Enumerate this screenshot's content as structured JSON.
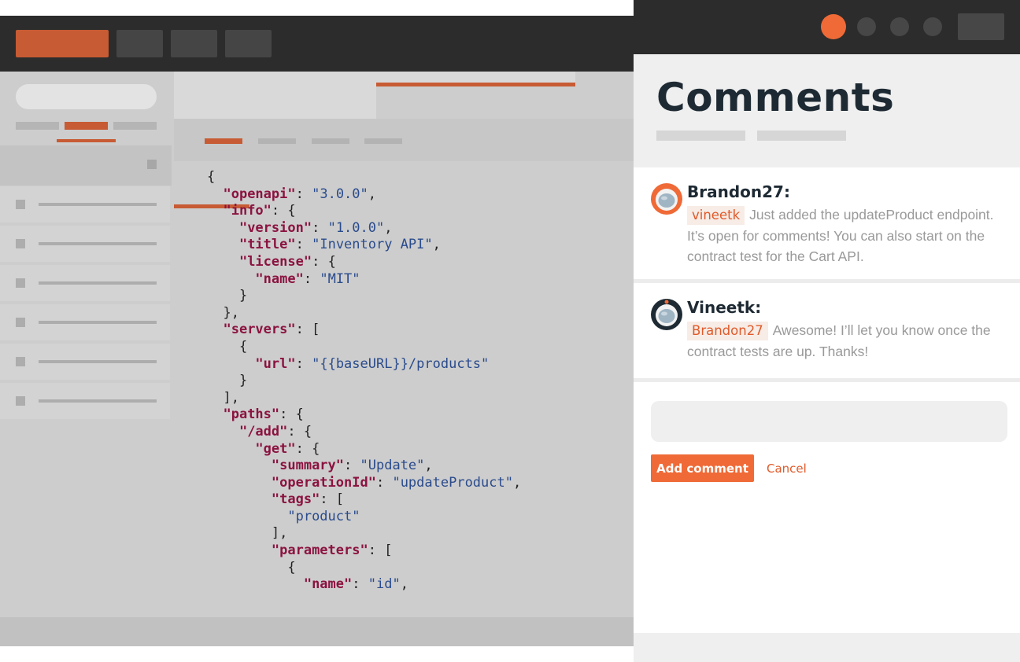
{
  "comments_panel": {
    "title": "Comments",
    "comments": [
      {
        "author": "Brandon27:",
        "mention": "vineetk",
        "text": "Just added the updateProduct endpoint. It’s open for comments! You can also start on the contract test for the Cart API."
      },
      {
        "author": "Vineetk:",
        "mention": "Brandon27",
        "text": "Awesome! I’ll let you know once the contract tests are up. Thanks!"
      }
    ],
    "input_placeholder": "",
    "add_button": "Add comment",
    "cancel": "Cancel"
  },
  "editor": {
    "code_lines": [
      "{",
      "  \"openapi\": \"3.0.0\",",
      "  \"info\": {",
      "    \"version\": \"1.0.0\",",
      "    \"title\": \"Inventory API\",",
      "    \"license\": {",
      "      \"name\": \"MIT\"",
      "    }",
      "  },",
      "  \"servers\": [",
      "    {",
      "      \"url\": \"{{baseURL}}/products\"",
      "    }",
      "  ],",
      "  \"paths\": {",
      "    \"/add\": {",
      "      \"get\": {",
      "        \"summary\": \"Update\",",
      "        \"operationId\": \"updateProduct\",",
      "        \"tags\": [",
      "          \"product\"",
      "        ],",
      "        \"parameters\": [",
      "          {",
      "            \"name\": \"id\","
    ]
  },
  "colors": {
    "accent": "#ef6a37",
    "key": "#8b1340",
    "string": "#2a4b8c",
    "dark": "#2c2c2c"
  },
  "icons": {
    "avatar_1": "astronaut-avatar-icon",
    "avatar_2": "astronaut-avatar-icon"
  }
}
